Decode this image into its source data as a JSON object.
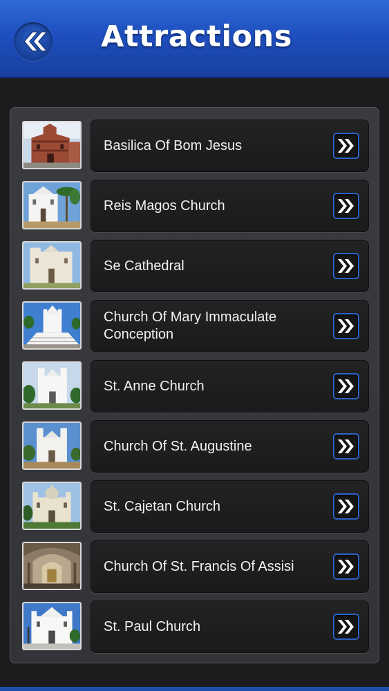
{
  "header": {
    "title": "Attractions",
    "back_icon": "double-chevron-left-icon",
    "colors": {
      "bar": "#1f4fbf",
      "title_text": "#ffffff"
    }
  },
  "attractions": [
    {
      "label": "Basilica Of Bom Jesus",
      "thumb": "basilica-thumbnail"
    },
    {
      "label": "Reis Magos Church",
      "thumb": "reis-magos-thumbnail"
    },
    {
      "label": "Se Cathedral",
      "thumb": "se-cathedral-thumbnail"
    },
    {
      "label": "Church Of Mary Immaculate Conception",
      "thumb": "mary-immaculate-thumbnail"
    },
    {
      "label": "St. Anne Church",
      "thumb": "st-anne-thumbnail"
    },
    {
      "label": "Church Of St. Augustine",
      "thumb": "st-augustine-thumbnail"
    },
    {
      "label": "St. Cajetan Church",
      "thumb": "st-cajetan-thumbnail"
    },
    {
      "label": "Church Of St. Francis Of Assisi",
      "thumb": "st-francis-thumbnail"
    },
    {
      "label": "St. Paul Church",
      "thumb": "st-paul-thumbnail"
    }
  ],
  "row_arrow_icon": "double-chevron-right-icon",
  "colors": {
    "background": "#1c1c1e",
    "panel": "#38393d",
    "row": "#1f1f21",
    "row_text": "#f2f2f2",
    "arrow_border": "#2c63c6"
  }
}
